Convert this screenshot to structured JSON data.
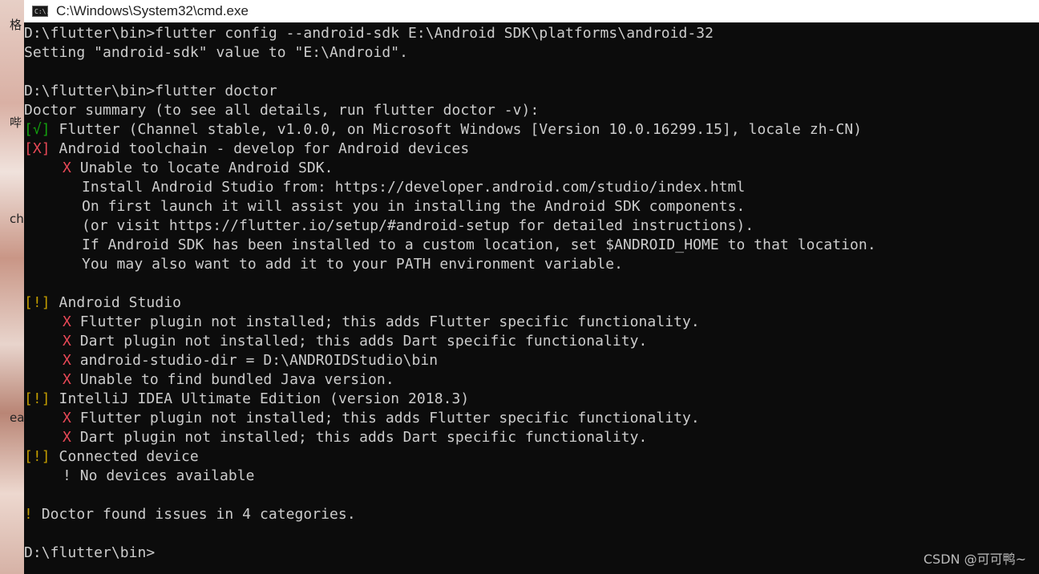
{
  "window": {
    "title": "C:\\Windows\\System32\\cmd.exe",
    "icon": "cmd-icon",
    "icon_text": "C:\\."
  },
  "desktop": {
    "fragments": [
      "格",
      "哔",
      "ch",
      "ea"
    ]
  },
  "console": {
    "lines": [
      {
        "text": "D:\\flutter\\bin>flutter config --android-sdk E:\\Android SDK\\platforms\\android-32"
      },
      {
        "text": "Setting \"android-sdk\" value to \"E:\\Android\"."
      },
      {
        "text": "D:\\flutter\\bin>flutter doctor"
      },
      {
        "text": "Doctor summary (to see all details, run flutter doctor -v):"
      },
      {
        "marker": "[√]",
        "text": " Flutter (Channel stable, v1.0.0, on Microsoft Windows [Version 10.0.16299.15], locale zh-CN)"
      },
      {
        "marker": "[X]",
        "text": " Android toolchain - develop for Android devices"
      },
      {
        "marker": "X",
        "text": " Unable to locate Android SDK."
      },
      {
        "text": "Install Android Studio from: https://developer.android.com/studio/index.html"
      },
      {
        "text": "On first launch it will assist you in installing the Android SDK components."
      },
      {
        "text": "(or visit https://flutter.io/setup/#android-setup for detailed instructions)."
      },
      {
        "text": "If Android SDK has been installed to a custom location, set $ANDROID_HOME to that location."
      },
      {
        "text": "You may also want to add it to your PATH environment variable."
      },
      {
        "marker": "[!]",
        "text": " Android Studio"
      },
      {
        "marker": "X",
        "text": " Flutter plugin not installed; this adds Flutter specific functionality."
      },
      {
        "marker": "X",
        "text": " Dart plugin not installed; this adds Dart specific functionality."
      },
      {
        "marker": "X",
        "text": " android-studio-dir = D:\\ANDROIDStudio\\bin"
      },
      {
        "marker": "X",
        "text": " Unable to find bundled Java version."
      },
      {
        "marker": "[!]",
        "text": " IntelliJ IDEA Ultimate Edition (version 2018.3)"
      },
      {
        "marker": "X",
        "text": " Flutter plugin not installed; this adds Flutter specific functionality."
      },
      {
        "marker": "X",
        "text": " Dart plugin not installed; this adds Dart specific functionality."
      },
      {
        "marker": "[!]",
        "text": " Connected device"
      },
      {
        "text": "! No devices available"
      },
      {
        "marker": "!",
        "text": " Doctor found issues in 4 categories."
      },
      {
        "text": "D:\\flutter\\bin>"
      }
    ]
  },
  "colors": {
    "ok": "#13a10e",
    "error": "#e74856",
    "warning": "#c19c00",
    "text": "#cccccc",
    "background": "#0c0c0c"
  },
  "watermark": "CSDN @可可鸭~"
}
